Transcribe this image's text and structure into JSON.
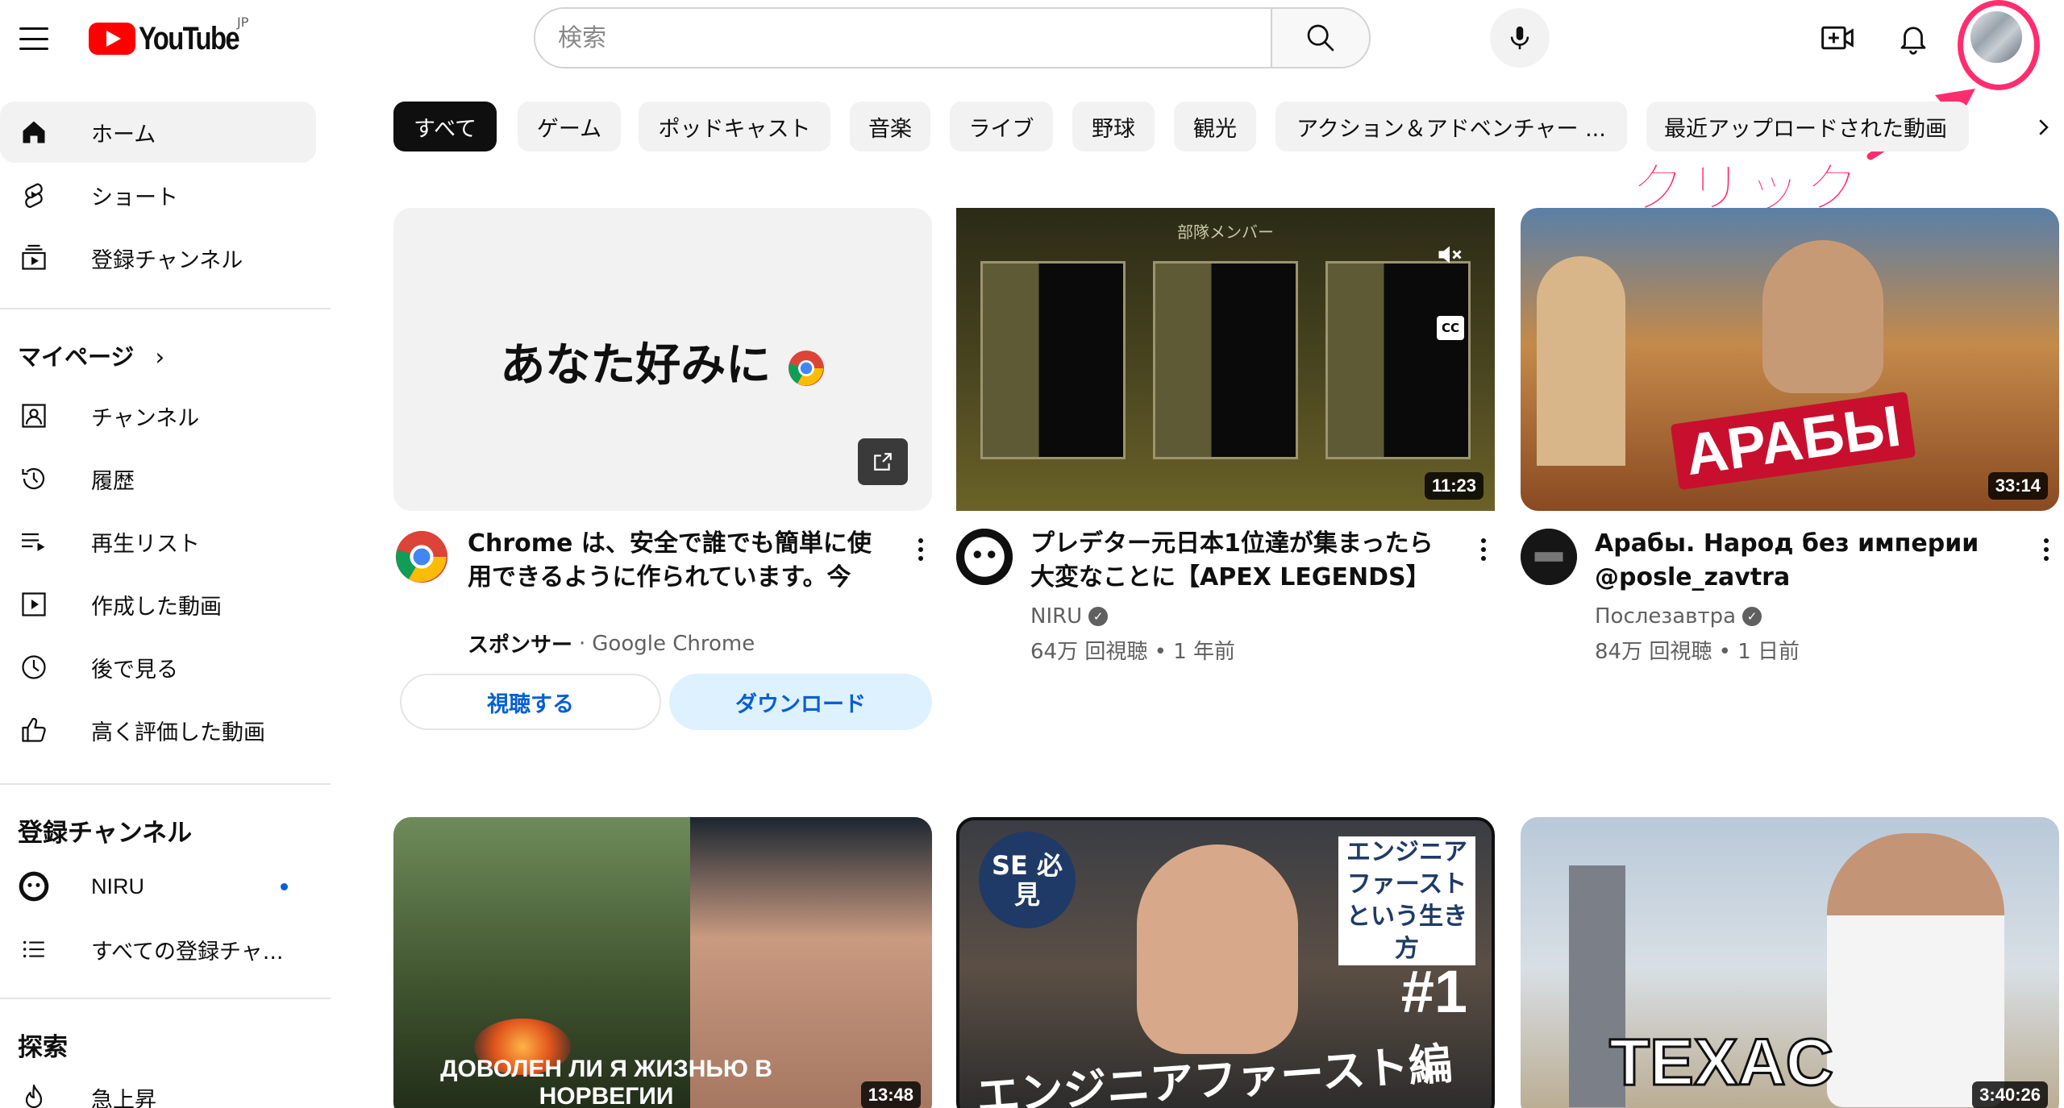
{
  "header": {
    "logo_text": "YouTube",
    "region": "JP",
    "search_placeholder": "検索"
  },
  "annotation": {
    "text": "クリック",
    "color": "#ff2d6e"
  },
  "sidebar": {
    "main_items": [
      {
        "label": "ホーム",
        "icon": "home-icon",
        "active": true
      },
      {
        "label": "ショート",
        "icon": "shorts-icon"
      },
      {
        "label": "登録チャンネル",
        "icon": "subscriptions-icon"
      }
    ],
    "you_section_title": "マイページ",
    "you_items": [
      {
        "label": "チャンネル",
        "icon": "channel-icon"
      },
      {
        "label": "履歴",
        "icon": "history-icon"
      },
      {
        "label": "再生リスト",
        "icon": "playlists-icon"
      },
      {
        "label": "作成した動画",
        "icon": "your-videos-icon"
      },
      {
        "label": "後で見る",
        "icon": "watch-later-icon"
      },
      {
        "label": "高く評価した動画",
        "icon": "liked-videos-icon"
      }
    ],
    "subscriptions_title": "登録チャンネル",
    "subscriptions": [
      {
        "label": "NIRU",
        "has_new": true
      },
      {
        "label": "すべての登録チャ..."
      }
    ],
    "explore_title": "探索",
    "explore_items": [
      {
        "label": "急上昇",
        "icon": "trending-icon"
      }
    ]
  },
  "chips": [
    "すべて",
    "ゲーム",
    "ポッドキャスト",
    "音楽",
    "ライブ",
    "野球",
    "観光",
    "アクション＆アドベンチャー ...",
    "最近アップロードされた動画"
  ],
  "ad": {
    "thumb_text": "あなた好みに",
    "title": "Chrome は、安全で誰でも簡単に使用できるように作られています。今す...",
    "sponsor_label": "スポンサー",
    "sponsor_name": "Google Chrome",
    "watch_label": "視聴する",
    "download_label": "ダウンロード"
  },
  "videos": [
    {
      "title": "プレデター元日本1位達が集まったら大変なことに【APEX LEGENDS】",
      "channel": "NIRU",
      "verified": true,
      "meta": "64万 回視聴 • 1 年前",
      "duration": "11:23",
      "thumb_caption": "部隊メンバー"
    },
    {
      "title": "Арабы. Народ без империи @posle_zavtra",
      "channel": "Послезавтра",
      "verified": true,
      "meta": "84万 回視聴 • 1 日前",
      "duration": "33:14",
      "thumb_caption": "АРАБЫ"
    }
  ],
  "row2": [
    {
      "duration": "13:48",
      "thumb_caption": "ДОВОЛЕН ЛИ Я ЖИЗНЬЮ В НОРВЕГИИ"
    },
    {
      "duration": "",
      "thumb_caption": "エンジニアファースト編",
      "badge": "SE 必見",
      "side_text": "エンジニア ファースト という生き方",
      "number": "#1"
    },
    {
      "duration": "3:40:26",
      "thumb_caption": "TEXAC"
    }
  ]
}
